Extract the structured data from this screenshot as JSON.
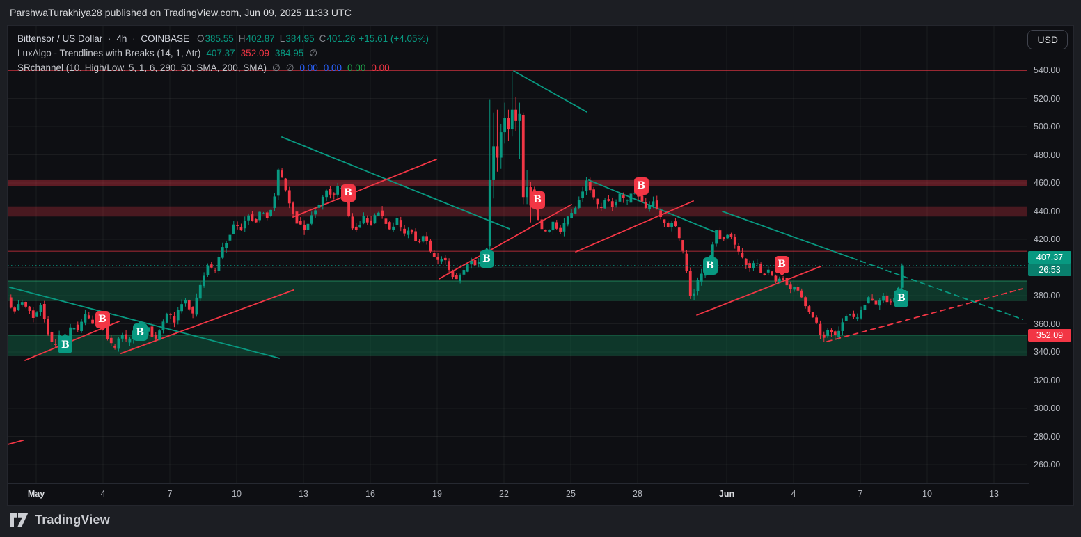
{
  "meta": {
    "attribution": "ParshwaTurakhiya28 published on TradingView.com, Jun 09, 2025 11:33 UTC"
  },
  "currency_button": "USD",
  "footer": {
    "brand": "TradingView"
  },
  "colors": {
    "up": "#089981",
    "down": "#f23645",
    "teal_line": "#089981",
    "red_line": "#f23645",
    "grid": "rgba(255,255,255,0.055)",
    "axis_text": "#b4b7be",
    "blue_value": "#2962ff",
    "green_value": "#1eaa4e",
    "muted": "#85888f"
  },
  "header": {
    "symbol": "Bittensor / US Dollar",
    "interval": "4h",
    "exchange": "COINBASE",
    "ohlc": [
      {
        "k": "O",
        "v": "385.55"
      },
      {
        "k": "H",
        "v": "402.87"
      },
      {
        "k": "L",
        "v": "384.95"
      },
      {
        "k": "C",
        "v": "401.26"
      }
    ],
    "change": "+15.61 (+4.05%)",
    "indicators": [
      {
        "name": "LuxAlgo - Trendlines with Breaks (14, 1, Atr)",
        "values": [
          {
            "t": "407.37",
            "c": "#089981"
          },
          {
            "t": "352.09",
            "c": "#f23645"
          },
          {
            "t": "384.95",
            "c": "#089981"
          },
          {
            "t": "∅",
            "c": "#85888f"
          }
        ]
      },
      {
        "name": "SRchannel (10, High/Low, 5, 1, 6, 290, 50, SMA, 200, SMA)",
        "values": [
          {
            "t": "∅",
            "c": "#85888f"
          },
          {
            "t": "∅",
            "c": "#85888f"
          },
          {
            "t": "0.00",
            "c": "#2962ff"
          },
          {
            "t": "0.00",
            "c": "#2962ff"
          },
          {
            "t": "0.00",
            "c": "#1eaa4e"
          },
          {
            "t": "0.00",
            "c": "#f23645"
          }
        ]
      }
    ]
  },
  "chart_data": {
    "type": "candlestick",
    "title": "Bittensor / US Dollar · 4h · COINBASE",
    "interval": "4h",
    "candles_per_day": 6,
    "start_day": -1.2,
    "count": 241,
    "current_price": 401.26,
    "countdown": "26:53",
    "last_candle": {
      "open": 385.55,
      "high": 402.87,
      "low": 384.95,
      "close": 401.26
    },
    "y_axis": {
      "tick_min": 260,
      "tick_max": 540,
      "tick_step": 20,
      "grid_max": 560,
      "unit": "USD"
    },
    "x_axis": {
      "ticks": [
        {
          "label": "May",
          "d": 0,
          "month": true
        },
        {
          "label": "4",
          "d": 3
        },
        {
          "label": "7",
          "d": 6
        },
        {
          "label": "10",
          "d": 9
        },
        {
          "label": "13",
          "d": 12
        },
        {
          "label": "16",
          "d": 15
        },
        {
          "label": "19",
          "d": 18
        },
        {
          "label": "22",
          "d": 21
        },
        {
          "label": "25",
          "d": 24
        },
        {
          "label": "28",
          "d": 27
        },
        {
          "label": "Jun",
          "d": 31,
          "month": true
        },
        {
          "label": "4",
          "d": 34
        },
        {
          "label": "7",
          "d": 37
        },
        {
          "label": "10",
          "d": 40
        },
        {
          "label": "13",
          "d": 43
        }
      ]
    },
    "price_path_waypoints": [
      [
        -1.2,
        378
      ],
      [
        -0.9,
        368
      ],
      [
        -0.6,
        376
      ],
      [
        -0.3,
        371
      ],
      [
        0,
        363
      ],
      [
        0.3,
        373
      ],
      [
        0.6,
        355
      ],
      [
        0.9,
        342
      ],
      [
        1.1,
        352
      ],
      [
        1.4,
        347
      ],
      [
        1.7,
        360
      ],
      [
        2,
        355
      ],
      [
        2.3,
        367
      ],
      [
        2.6,
        360
      ],
      [
        3,
        365
      ],
      [
        3.3,
        350
      ],
      [
        3.6,
        342
      ],
      [
        3.9,
        354
      ],
      [
        4.2,
        346
      ],
      [
        4.5,
        356
      ],
      [
        4.8,
        350
      ],
      [
        5.1,
        360
      ],
      [
        5.4,
        347
      ],
      [
        5.7,
        358
      ],
      [
        6,
        368
      ],
      [
        6.3,
        362
      ],
      [
        6.6,
        374
      ],
      [
        6.9,
        379
      ],
      [
        7.05,
        362
      ],
      [
        7.2,
        372
      ],
      [
        7.5,
        390
      ],
      [
        7.8,
        401
      ],
      [
        8.1,
        397
      ],
      [
        8.4,
        412
      ],
      [
        8.7,
        420
      ],
      [
        9,
        431
      ],
      [
        9.3,
        427
      ],
      [
        9.6,
        438
      ],
      [
        9.9,
        431
      ],
      [
        10.2,
        441
      ],
      [
        10.5,
        435
      ],
      [
        10.8,
        450
      ],
      [
        11,
        474
      ],
      [
        11.2,
        459
      ],
      [
        11.5,
        445
      ],
      [
        11.8,
        432
      ],
      [
        12.2,
        426
      ],
      [
        12.5,
        438
      ],
      [
        12.8,
        445
      ],
      [
        13.1,
        456
      ],
      [
        13.4,
        449
      ],
      [
        13.7,
        459
      ],
      [
        14,
        452
      ],
      [
        14.2,
        429
      ],
      [
        14.5,
        427
      ],
      [
        14.8,
        436
      ],
      [
        15.1,
        430
      ],
      [
        15.4,
        441
      ],
      [
        15.7,
        434
      ],
      [
        16,
        427
      ],
      [
        16.3,
        434
      ],
      [
        16.6,
        423
      ],
      [
        16.9,
        428
      ],
      [
        17.2,
        417
      ],
      [
        17.5,
        424
      ],
      [
        17.8,
        411
      ],
      [
        18.1,
        404
      ],
      [
        18.4,
        408
      ],
      [
        18.7,
        395
      ],
      [
        19,
        391
      ],
      [
        19.3,
        398
      ],
      [
        19.6,
        406
      ],
      [
        19.9,
        401
      ],
      [
        20.2,
        411
      ],
      [
        20.35,
        414
      ],
      [
        20.5,
        466
      ],
      [
        20.7,
        483
      ],
      [
        20.9,
        495
      ],
      [
        21.1,
        499
      ],
      [
        21.3,
        503
      ],
      [
        21.5,
        507
      ],
      [
        21.7,
        508
      ],
      [
        21.9,
        504
      ],
      [
        22.05,
        496
      ],
      [
        22.2,
        452
      ],
      [
        22.35,
        456
      ],
      [
        22.5,
        444
      ],
      [
        22.7,
        429
      ],
      [
        23,
        424
      ],
      [
        23.3,
        432
      ],
      [
        23.6,
        425
      ],
      [
        23.9,
        434
      ],
      [
        24.2,
        440
      ],
      [
        24.5,
        450
      ],
      [
        24.8,
        461
      ],
      [
        25.1,
        450
      ],
      [
        25.4,
        441
      ],
      [
        25.7,
        450
      ],
      [
        26,
        443
      ],
      [
        26.3,
        452
      ],
      [
        26.6,
        446
      ],
      [
        26.9,
        455
      ],
      [
        27.2,
        449
      ],
      [
        27.5,
        441
      ],
      [
        27.8,
        447
      ],
      [
        28.1,
        436
      ],
      [
        28.4,
        428
      ],
      [
        28.7,
        433
      ],
      [
        29,
        419
      ],
      [
        29.2,
        407
      ],
      [
        29.5,
        377
      ],
      [
        29.8,
        390
      ],
      [
        30.1,
        398
      ],
      [
        30.3,
        404
      ],
      [
        30.6,
        427
      ],
      [
        30.9,
        419
      ],
      [
        31.2,
        424
      ],
      [
        31.5,
        414
      ],
      [
        31.8,
        407
      ],
      [
        32.1,
        399
      ],
      [
        32.4,
        404
      ],
      [
        32.7,
        394
      ],
      [
        33,
        398
      ],
      [
        33.3,
        389
      ],
      [
        33.6,
        393
      ],
      [
        33.9,
        384
      ],
      [
        34.2,
        388
      ],
      [
        34.5,
        377
      ],
      [
        34.8,
        369
      ],
      [
        35.1,
        361
      ],
      [
        35.4,
        349
      ],
      [
        35.7,
        356
      ],
      [
        36,
        351
      ],
      [
        36.3,
        362
      ],
      [
        36.6,
        368
      ],
      [
        36.9,
        363
      ],
      [
        37.2,
        371
      ],
      [
        37.5,
        379
      ],
      [
        37.8,
        373
      ],
      [
        38.1,
        381
      ],
      [
        38.4,
        374
      ],
      [
        38.7,
        379
      ],
      [
        38.9,
        385
      ],
      [
        39.2,
        401
      ]
    ],
    "candle_overrides": {
      "129": [
        415,
        462,
        519,
        411
      ],
      "130": [
        462,
        486,
        510,
        449
      ],
      "131": [
        486,
        478,
        512,
        468
      ],
      "132": [
        478,
        496,
        502,
        470
      ],
      "133": [
        496,
        506,
        517,
        488
      ],
      "134": [
        506,
        498,
        512,
        490
      ],
      "135": [
        498,
        512,
        539,
        493
      ],
      "136": [
        512,
        504,
        521,
        497
      ],
      "137": [
        504,
        509,
        517,
        477
      ],
      "138": [
        508,
        450,
        510,
        445
      ],
      "139": [
        450,
        457,
        469,
        445
      ],
      "140": [
        457,
        444,
        461,
        432
      ],
      "239": [
        377,
        385.5,
        386.5,
        374
      ],
      "240": [
        385.55,
        401.26,
        402.87,
        384.95
      ]
    },
    "trendlines": [
      {
        "id": "teal-0",
        "d1": -1.19,
        "p1": 385.9,
        "d2": 10.91,
        "p2": 335.6,
        "color": "teal",
        "dashed": false
      },
      {
        "id": "teal-1",
        "d1": 11.03,
        "p1": 492.6,
        "d2": 21.25,
        "p2": 427.4,
        "color": "teal",
        "dashed": false
      },
      {
        "id": "teal-2",
        "d1": 21.44,
        "p1": 539.5,
        "d2": 24.72,
        "p2": 510.4,
        "color": "teal",
        "dashed": false
      },
      {
        "id": "teal-3",
        "d1": 24.81,
        "p1": 462.0,
        "d2": 30.5,
        "p2": 425.0,
        "color": "teal",
        "dashed": false
      },
      {
        "id": "teal-4",
        "d1": 30.81,
        "p1": 439.8,
        "d2": 36.63,
        "p2": 406.7,
        "color": "teal",
        "dashed": false
      },
      {
        "id": "teal-4-projection",
        "d1": 36.63,
        "p1": 406.7,
        "d2": 44.28,
        "p2": 363.2,
        "color": "teal",
        "dashed": true
      },
      {
        "id": "red-0",
        "d1": -0.5,
        "p1": 334.1,
        "d2": 3.72,
        "p2": 361.7,
        "color": "red",
        "dashed": false
      },
      {
        "id": "red-1",
        "d1": 3.81,
        "p1": 339.0,
        "d2": 11.56,
        "p2": 384.0,
        "color": "red",
        "dashed": false
      },
      {
        "id": "red-2",
        "d1": 11.53,
        "p1": 435.8,
        "d2": 17.97,
        "p2": 476.8,
        "color": "red",
        "dashed": false
      },
      {
        "id": "red-3",
        "d1": 18.09,
        "p1": 391.9,
        "d2": 24.03,
        "p2": 444.7,
        "color": "red",
        "dashed": false
      },
      {
        "id": "red-4",
        "d1": 24.22,
        "p1": 411.1,
        "d2": 29.5,
        "p2": 447.2,
        "color": "red",
        "dashed": false
      },
      {
        "id": "red-5",
        "d1": 29.66,
        "p1": 366.2,
        "d2": 35.22,
        "p2": 400.7,
        "color": "red",
        "dashed": false
      },
      {
        "id": "red-projection",
        "d1": 35.5,
        "p1": 347.4,
        "d2": 44.28,
        "p2": 384.9,
        "color": "red",
        "dashed": true
      },
      {
        "id": "red-left-edge",
        "d1": -1.28,
        "p1": 274.3,
        "d2": -0.59,
        "p2": 277.3,
        "color": "red",
        "dashed": false
      }
    ],
    "break_markers": [
      {
        "d": 1.31,
        "price": 345,
        "dir": "up"
      },
      {
        "d": 2.97,
        "price": 363,
        "dir": "down"
      },
      {
        "d": 4.66,
        "price": 354,
        "dir": "up"
      },
      {
        "d": 14.0,
        "price": 453,
        "dir": "down"
      },
      {
        "d": 20.22,
        "price": 406,
        "dir": "up"
      },
      {
        "d": 22.5,
        "price": 448,
        "dir": "down"
      },
      {
        "d": 27.16,
        "price": 458,
        "dir": "down"
      },
      {
        "d": 30.25,
        "price": 401,
        "dir": "up"
      },
      {
        "d": 33.47,
        "price": 402,
        "dir": "down"
      },
      {
        "d": 38.84,
        "price": 378,
        "dir": "up"
      }
    ],
    "sr_levels": {
      "horizontal_lines": [
        {
          "price": 540.0,
          "w": 2,
          "alpha": 0.6
        },
        {
          "price": 411.5,
          "w": 1.5,
          "alpha": 0.45
        }
      ],
      "red_bands": [
        {
          "top": 462.0,
          "bottom": 458.0,
          "fill": 0.35,
          "edges": false
        },
        {
          "top": 443.0,
          "bottom": 436.5,
          "fill": 0.26,
          "edges": true
        }
      ],
      "green_bands": [
        {
          "top": 390.4,
          "bottom": 376.6
        },
        {
          "top": 351.9,
          "bottom": 337.6
        }
      ]
    },
    "price_labels": [
      {
        "text": "407.37",
        "price": 407.37,
        "kind": "trendline-upper",
        "bg": "#089981"
      },
      {
        "text": "26:53",
        "price": 401.26,
        "kind": "countdown",
        "bg": "rgba(8,153,129,0.82)"
      },
      {
        "text": "352.09",
        "price": 352.09,
        "kind": "trendline-lower",
        "bg": "#f23645"
      }
    ]
  }
}
